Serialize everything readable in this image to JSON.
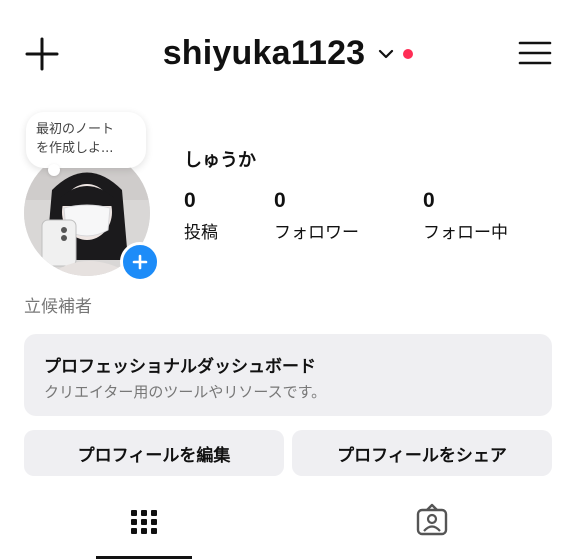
{
  "header": {
    "username": "shiyuka1123",
    "icons": {
      "left": "plus-icon",
      "dropdown": "chevron-down-icon",
      "menu": "menu-icon"
    },
    "notification_dot_color": "#ff2d55"
  },
  "profile": {
    "note_lines": [
      "最初のノート",
      "を作成しよ..."
    ],
    "display_name": "しゅうか",
    "stats": [
      {
        "value": "0",
        "label": "投稿"
      },
      {
        "value": "0",
        "label": "フォロワー"
      },
      {
        "value": "0",
        "label": "フォロー中"
      }
    ],
    "category": "立候補者",
    "add_icon_color": "#1d8cf8"
  },
  "dashboard": {
    "title": "プロフェッショナルダッシュボード",
    "subtitle": "クリエイター用のツールやリソースです。"
  },
  "buttons": {
    "edit_profile": "プロフィールを編集",
    "share_profile": "プロフィールをシェア"
  },
  "tabs": [
    {
      "icon": "grid-icon",
      "active": true
    },
    {
      "icon": "tagged-icon",
      "active": false
    }
  ]
}
